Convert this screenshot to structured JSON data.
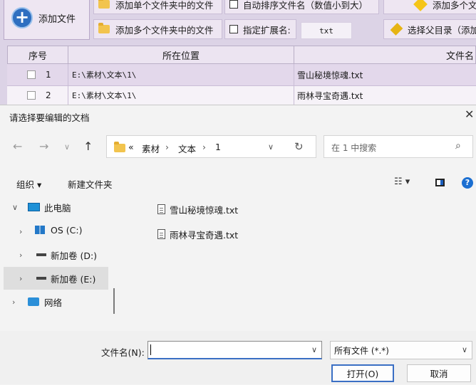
{
  "app": {
    "add_file_label": "添加文件",
    "toolbar": {
      "add_single_folder": "添加单个文件夹中的文件",
      "add_multi_folders": "添加多个文件夹中的文件",
      "auto_sort": "自动排序文件名（数值小到大）",
      "specify_ext": "指定扩展名:",
      "ext_value": "txt",
      "add_multi_partial": "添加多个文",
      "select_parent": "选择父目录（添加"
    },
    "table": {
      "headers": [
        "序号",
        "所在位置",
        "文件名"
      ],
      "rows": [
        {
          "index": "1",
          "location": "E:\\素材\\文本\\1\\",
          "filename": "雪山秘境惊魂.txt"
        },
        {
          "index": "2",
          "location": "E:\\素材\\文本\\1\\",
          "filename": "雨林寻宝奇遇.txt"
        }
      ]
    }
  },
  "dialog": {
    "title": "请选择要编辑的文档",
    "breadcrumb": [
      "«",
      "素材",
      "›",
      "文本",
      "›",
      "1"
    ],
    "search_placeholder": "在 1 中搜索",
    "organize_label": "组织 ▾",
    "new_folder_label": "新建文件夹",
    "tree": [
      {
        "label": "此电脑",
        "icon": "pc-icon"
      },
      {
        "label": "OS (C:)",
        "icon": "windows-drive-icon"
      },
      {
        "label": "新加卷 (D:)",
        "icon": "drive-icon"
      },
      {
        "label": "新加卷 (E:)",
        "icon": "drive-icon"
      },
      {
        "label": "网络",
        "icon": "network-icon"
      }
    ],
    "files": [
      "雪山秘境惊魂.txt",
      "雨林寻宝奇遇.txt"
    ],
    "filename_label": "文件名(N):",
    "filename_value": "",
    "filetype_value": "所有文件 (*.*)",
    "open_button": "打开(O)",
    "cancel_button": "取消"
  }
}
